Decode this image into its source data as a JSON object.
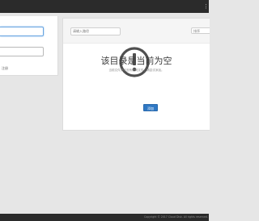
{
  "header": {
    "menu_icon": "menu-icon"
  },
  "login_panel": {
    "username_placeholder": "",
    "password_placeholder": "",
    "link_text": "注册"
  },
  "file_panel": {
    "search": {
      "placeholder": "请输入路径"
    },
    "sort": {
      "selected": "排序"
    },
    "empty_state": {
      "icon": "alert-circle-icon",
      "title": "该目录是当前为空",
      "description": "当前文件夹中没有任何文件，请尝试添加。",
      "add_button": "添加"
    }
  },
  "footer": {
    "copyright": "Copyright © 2017 Cloud Disk. All rights reserved."
  },
  "colors": {
    "topbar": "#2b2b2b",
    "background": "#e6e6e6",
    "accent": "#2f78c4",
    "icon": "#505050"
  }
}
